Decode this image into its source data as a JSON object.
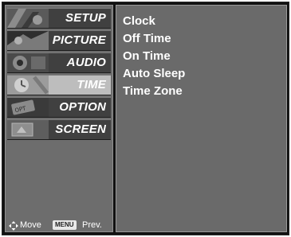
{
  "left_menu": {
    "items": [
      {
        "label": "SETUP",
        "icon": "setup-icon",
        "selected": false
      },
      {
        "label": "PICTURE",
        "icon": "picture-icon",
        "selected": false
      },
      {
        "label": "AUDIO",
        "icon": "audio-icon",
        "selected": false
      },
      {
        "label": "TIME",
        "icon": "time-icon",
        "selected": true
      },
      {
        "label": "OPTION",
        "icon": "option-icon",
        "selected": false
      },
      {
        "label": "SCREEN",
        "icon": "screen-icon",
        "selected": false
      }
    ]
  },
  "footer": {
    "move_label": "Move",
    "menu_key_label": "MENU",
    "prev_label": "Prev."
  },
  "submenu": {
    "items": [
      "Clock",
      "Off Time",
      "On Time",
      "Auto Sleep",
      "Time Zone"
    ]
  },
  "colors": {
    "panel_bg": "#6a6a6a",
    "item_bg": "#404040",
    "selected_bg": "#bdbdbd",
    "text": "#ffffff"
  }
}
